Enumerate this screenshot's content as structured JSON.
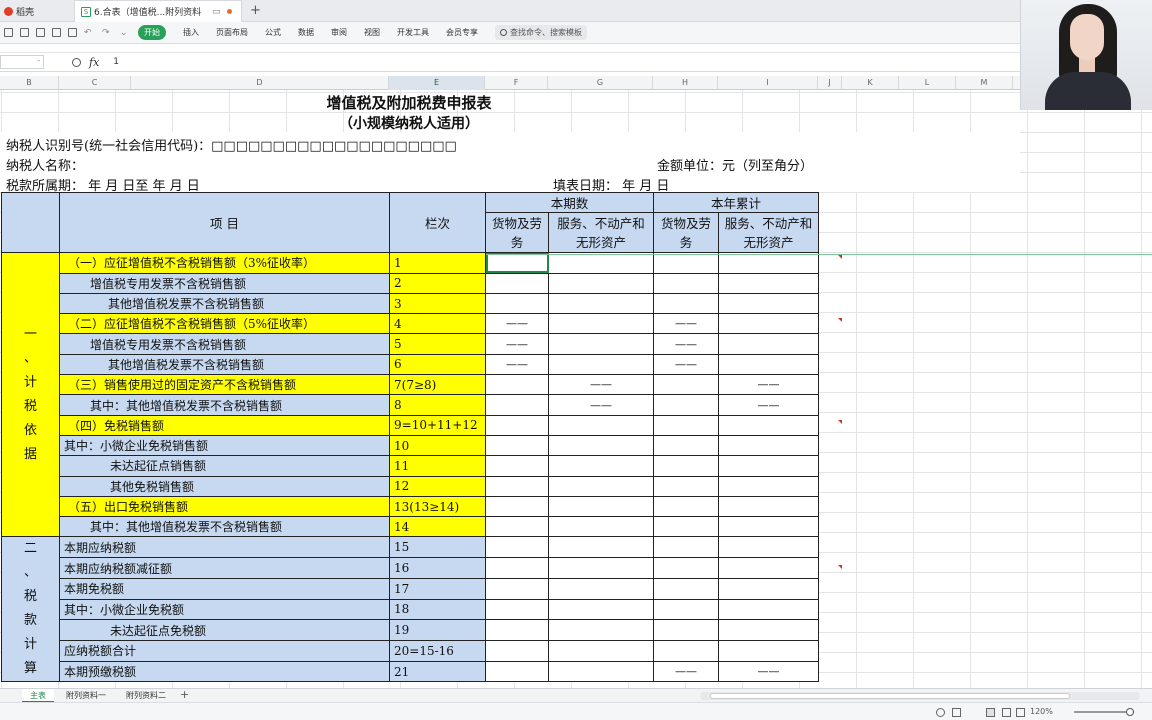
{
  "tabs": {
    "home": "稻壳",
    "document": "6.合表（增值税...附列资料 (1)"
  },
  "toolbar": {
    "menus": [
      "开始",
      "插入",
      "页面布局",
      "公式",
      "数据",
      "审阅",
      "视图",
      "开发工具",
      "会员专享"
    ],
    "search_placeholder": "查找命令、搜索模板"
  },
  "formula_bar": {
    "fx": "fx",
    "value": "1"
  },
  "columns": [
    "B",
    "C",
    "D",
    "E",
    "F",
    "G",
    "H",
    "I",
    "J",
    "K",
    "L",
    "M"
  ],
  "form": {
    "title": "增值税及附加税费申报表",
    "subtitle": "（小规模纳税人适用）",
    "taxpayer_id": "纳税人识别号(统一社会信用代码)：□□□□□□□□□□□□□□□□□□□□",
    "taxpayer_name": "纳税人名称：",
    "amount_unit": "金额单位：元（列至角分）",
    "period": "税款所属期：    年  月  日至      年  月  日",
    "fill_date": "填表日期：   年  月  日",
    "header": {
      "item": "项    目",
      "line": "栏次",
      "current_period": "本期数",
      "year_total": "本年累计",
      "goods": "货物及劳务",
      "services": "服务、不动产和无形资产"
    },
    "section1": "一\n、\n计\n税\n依\n据",
    "section2": "二\n、\n税\n款\n计\n算",
    "dash": "——",
    "rows": [
      {
        "item": "（一）应征增值税不含税销售额（3%征收率）",
        "line": "1"
      },
      {
        "item": "增值税专用发票不含税销售额",
        "line": "2"
      },
      {
        "item": "其他增值税发票不含税销售额",
        "line": "3"
      },
      {
        "item": "（二）应征增值税不含税销售额（5%征收率）",
        "line": "4"
      },
      {
        "item": "增值税专用发票不含税销售额",
        "line": "5"
      },
      {
        "item": "其他增值税发票不含税销售额",
        "line": "6"
      },
      {
        "item": "（三）销售使用过的固定资产不含税销售额",
        "line": "7(7≥8)"
      },
      {
        "item": "其中：其他增值税发票不含税销售额",
        "line": "8"
      },
      {
        "item": "（四）免税销售额",
        "line": "9=10+11+12"
      },
      {
        "item": "其中：小微企业免税销售额",
        "line": "10"
      },
      {
        "item": "未达起征点销售额",
        "line": "11"
      },
      {
        "item": "其他免税销售额",
        "line": "12"
      },
      {
        "item": "（五）出口免税销售额",
        "line": "13(13≥14)"
      },
      {
        "item": "其中：其他增值税发票不含税销售额",
        "line": "14"
      },
      {
        "item": "本期应纳税额",
        "line": "15"
      },
      {
        "item": "本期应纳税额减征额",
        "line": "16"
      },
      {
        "item": "本期免税额",
        "line": "17"
      },
      {
        "item": "其中：小微企业免税额",
        "line": "18"
      },
      {
        "item": "未达起征点免税额",
        "line": "19"
      },
      {
        "item": "应纳税额合计",
        "line": "20=15-16"
      },
      {
        "item": "本期预缴税额",
        "line": "21"
      }
    ]
  },
  "sheet_tabs": [
    "主表",
    "附列资料一",
    "附列资料二"
  ],
  "status": {
    "zoom": "120%"
  },
  "colors": {
    "yellow": "#ffff00",
    "blue": "#c6d9f1",
    "accent": "#27a15a"
  }
}
